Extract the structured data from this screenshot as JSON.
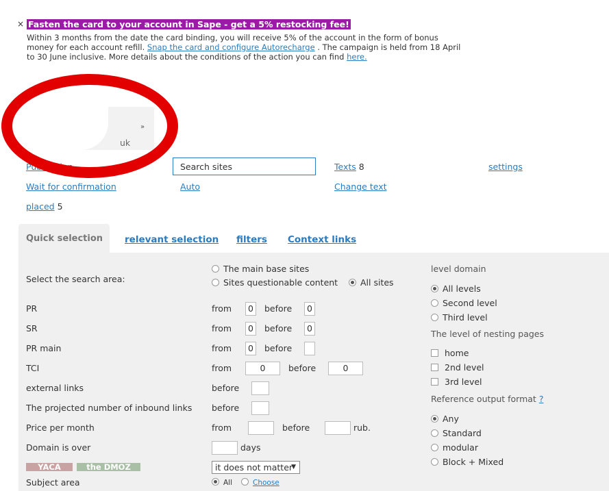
{
  "promo": {
    "close": "×",
    "title": "Fasten the card to your account in Sape - get a 5% restocking fee!",
    "body_1": "Within 3 months from the date the card binding, you will receive 5% of the account in the form of bonus money for each account refill.",
    "link_1": "Snap the card and configure Autorecharge",
    "body_2": ". The campaign is held from 18 April to 30 June inclusive. More details about the conditions of the action you can find",
    "link_2": "here."
  },
  "account": {
    "domain_suffix": "uk",
    "chevron": "»"
  },
  "nav": {
    "publication": "Publication",
    "search_sites": "Search sites",
    "texts": "Texts",
    "texts_count": "8",
    "settings": "settings",
    "wait_confirmation": "Wait for confirmation",
    "auto": "Auto",
    "change_text": "Change text",
    "placed": "placed",
    "placed_count": "5"
  },
  "tabs": [
    "Quick selection",
    "relevant selection",
    "filters",
    "Context links"
  ],
  "form": {
    "search_area_label": "Select the search area:",
    "area_options": [
      "The main base sites",
      "Sites questionable content",
      "All sites"
    ],
    "rows": {
      "pr": "PR",
      "sr": "SR",
      "pr_main": "PR main",
      "tci": "TCI",
      "external_links": "external links",
      "projected_inbound": "The projected number of inbound links",
      "price": "Price per month",
      "domain_over": "Domain is over",
      "subject": "Subject area"
    },
    "from": "from",
    "before": "before",
    "rub": "rub.",
    "days": "days",
    "values": {
      "pr_from": "0",
      "pr_before": "0",
      "sr_from": "0",
      "sr_before": "0",
      "pr_main_from": "0",
      "pr_main_before": "",
      "tci_from": "0",
      "tci_before": "0"
    },
    "yaca": "YACA",
    "dmoz": "the DMOZ",
    "dmoz_select": "it does not matter",
    "subject_all": "All",
    "subject_choose": "Choose"
  },
  "right": {
    "level_domain": "level domain",
    "levels": [
      "All levels",
      "Second level",
      "Third level"
    ],
    "nesting": "The level of nesting pages",
    "nesting_options": [
      "home",
      "2nd level",
      "3rd level"
    ],
    "ref_format": "Reference output format",
    "ref_help": "?",
    "formats": [
      "Any",
      "Standard",
      "modular",
      "Block + Mixed"
    ]
  },
  "colors": {
    "promo_bg": "#9b1aa6",
    "link": "#2a7bbf",
    "circle": "#e30000",
    "yaca": "#c9a3a3",
    "dmoz": "#a9bfa6"
  }
}
